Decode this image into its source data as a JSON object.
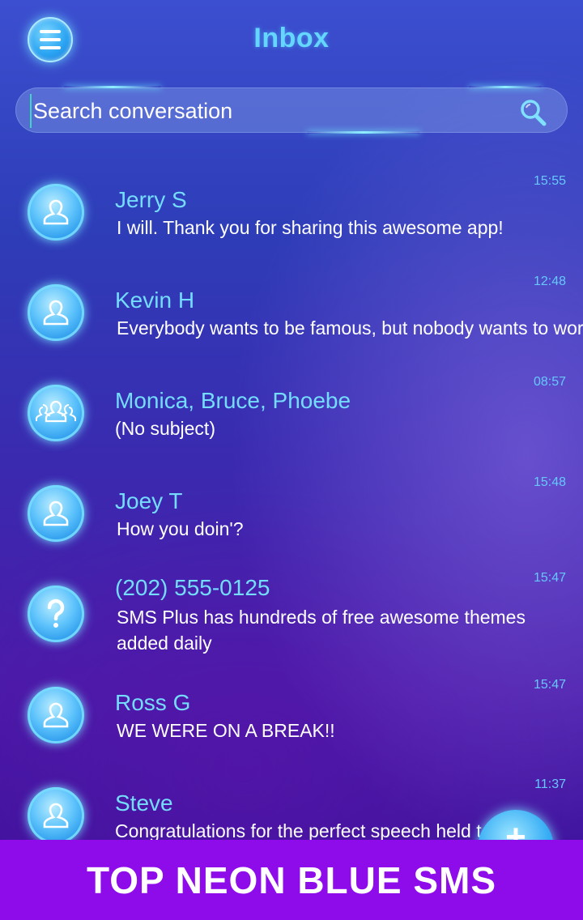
{
  "header": {
    "title": "Inbox"
  },
  "search": {
    "placeholder": "Search conversation"
  },
  "conversations": [
    {
      "name": "Jerry S",
      "snippet": "I will. Thank you for sharing this awesome app!",
      "time": "15:55",
      "avatar": "person-icon"
    },
    {
      "name": "Kevin H",
      "snippet": "Everybody wants to be famous, but nobody wants to work",
      "time": "12:48",
      "avatar": "person-icon"
    },
    {
      "name": "Monica, Bruce, Phoebe",
      "snippet": "(No subject)",
      "time": "08:57",
      "avatar": "group-icon"
    },
    {
      "name": "Joey T",
      "snippet": "How you doin'?",
      "time": "15:48",
      "avatar": "person-icon"
    },
    {
      "name": "(202) 555-0125",
      "snippet": "SMS Plus has hundreds of free awesome themes added daily",
      "time": "15:47",
      "avatar": "question-icon"
    },
    {
      "name": "Ross G",
      "snippet": "WE WERE ON A BREAK!!",
      "time": "15:47",
      "avatar": "person-icon"
    },
    {
      "name": "Steve",
      "snippet": "Congratulations for the perfect speech held tod",
      "time": "11:37",
      "avatar": "person-icon"
    }
  ],
  "fab": {
    "label": "+"
  },
  "banner": {
    "text": "TOP NEON BLUE SMS"
  },
  "colors": {
    "accent": "#65d6ff",
    "banner": "#8e0bea",
    "name": "#74dcff"
  }
}
